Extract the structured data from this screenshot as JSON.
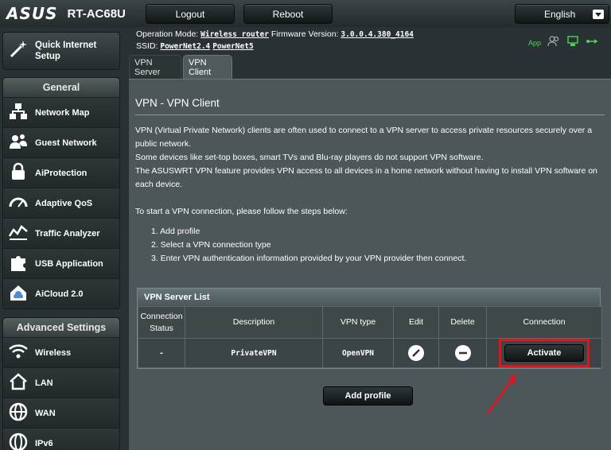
{
  "header": {
    "brand": "ASUS",
    "model": "RT-AC68U",
    "logout_label": "Logout",
    "reboot_label": "Reboot",
    "language": "English"
  },
  "status": {
    "operation_mode_label": "Operation Mode:",
    "operation_mode_value": "Wireless router",
    "firmware_label": "Firmware Version:",
    "firmware_value": "3.0.0.4.380_4164",
    "ssid_label": "SSID:",
    "ssid_1": "PowerNet2.4",
    "ssid_2": "PowerNet5",
    "app_label": "App"
  },
  "sidebar": {
    "quick_setup_label": "Quick Internet Setup",
    "general_header": "General",
    "general_items": [
      {
        "label": "Network Map",
        "icon": "network-map-icon"
      },
      {
        "label": "Guest Network",
        "icon": "guest-network-icon"
      },
      {
        "label": "AiProtection",
        "icon": "lock-icon"
      },
      {
        "label": "Adaptive QoS",
        "icon": "speedometer-icon"
      },
      {
        "label": "Traffic Analyzer",
        "icon": "traffic-chart-icon"
      },
      {
        "label": "USB Application",
        "icon": "puzzle-icon"
      },
      {
        "label": "AiCloud 2.0",
        "icon": "cloud-house-icon"
      }
    ],
    "advanced_header": "Advanced Settings",
    "advanced_items": [
      {
        "label": "Wireless",
        "icon": "wifi-icon"
      },
      {
        "label": "LAN",
        "icon": "house-icon"
      },
      {
        "label": "WAN",
        "icon": "globe-icon"
      },
      {
        "label": "IPv6",
        "icon": "ipv6-globe-icon"
      }
    ]
  },
  "tabs": [
    {
      "label": "VPN Server",
      "active": false
    },
    {
      "label": "VPN Client",
      "active": true
    }
  ],
  "main": {
    "title": "VPN - VPN Client",
    "intro_1": "VPN (Virtual Private Network) clients are often used to connect to a VPN server to access private resources securely over a public network.",
    "intro_2": "Some devices like set-top boxes, smart TVs and Blu-ray players do not support VPN software.",
    "intro_3": "The ASUSWRT VPN feature provides VPN access to all devices in a home network without having to install VPN software on each device.",
    "steps_intro": "To start a VPN connection, please follow the steps below:",
    "steps": [
      "1. Add profile",
      "2. Select a VPN connection type",
      "3. Enter VPN authentication information provided by your VPN provider then connect."
    ],
    "add_profile_label": "Add profile"
  },
  "vpn_table": {
    "caption": "VPN Server List",
    "headers": {
      "status": "Connection Status",
      "description": "Description",
      "type": "VPN type",
      "edit": "Edit",
      "delete": "Delete",
      "connection": "Connection"
    },
    "rows": [
      {
        "status": "-",
        "description": "PrivateVPN",
        "type": "OpenVPN",
        "connection_label": "Activate"
      }
    ]
  },
  "colors": {
    "background": "#2a3134",
    "panel": "#4d5759",
    "highlight": "#e0141d",
    "status_green": "#4fd34f"
  }
}
